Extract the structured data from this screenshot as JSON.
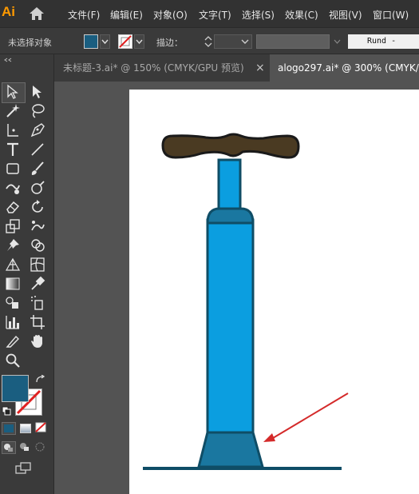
{
  "app": {
    "logo": "Ai"
  },
  "menu": {
    "items": [
      "文件(F)",
      "编辑(E)",
      "对象(O)",
      "文字(T)",
      "选择(S)",
      "效果(C)",
      "视图(V)",
      "窗口(W)"
    ]
  },
  "control_bar": {
    "selection_status": "未选择对象",
    "fill_color": "#1a5e80",
    "stroke_label": "描边：",
    "brush_value": "Rund -"
  },
  "tabs": [
    {
      "label": "未标题-3.ai* @ 150% (CMYK/GPU 预览)",
      "active": false,
      "close": "×"
    },
    {
      "label": "alogo297.ai* @ 300% (CMYK/",
      "active": true
    }
  ],
  "toolbar": {
    "fill_color": "#1a5e80",
    "stroke_color": "none"
  },
  "artwork": {
    "handle_color": "#4a3a22",
    "pipe_color": "#0b9ee0",
    "base_color": "#1a77a0",
    "outline_color": "#0f4d66",
    "arrow_color": "#d42a2a"
  }
}
